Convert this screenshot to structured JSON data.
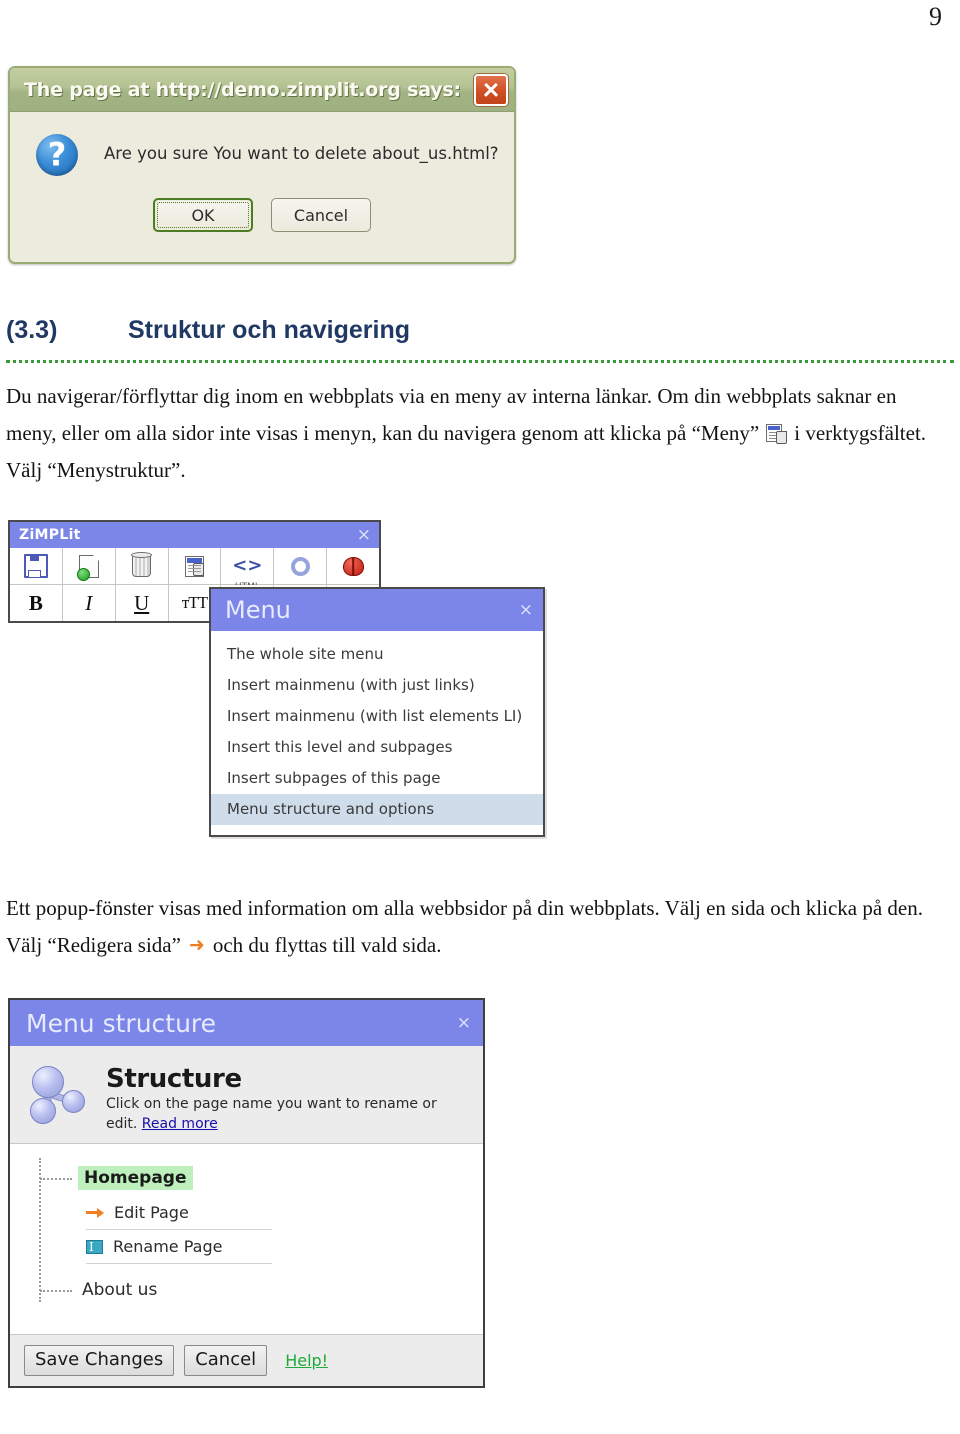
{
  "page": {
    "number": "9"
  },
  "alert_dialog": {
    "title": "The page at http://demo.zimplit.org says:",
    "message": "Are you sure You want to delete about_us.html?",
    "question_glyph": "?",
    "ok_label": "OK",
    "cancel_label": "Cancel",
    "close_label": "×"
  },
  "section": {
    "number": "(3.3)",
    "title": "Struktur och navigering",
    "heading_color": "#1f3864",
    "rule_color": "#3a9a3a"
  },
  "paragraphs": {
    "p1_part1": "Du navigerar/förflyttar dig inom en webbplats via en meny av interna länkar. Om din webbplats saknar en meny, eller om alla sidor inte visas i menyn, kan du navigera genom att klicka på “Meny”",
    "p1_part2": "i verktygsfältet.  Välj “Menystruktur”.",
    "p2_part1": "Ett popup-fönster visas med information om alla webbsidor på din webbplats. Välj en sida och klicka på den. Välj “Redigera sida”",
    "p2_arrow": "➜",
    "p2_part2": "och du flyttas till vald sida."
  },
  "zimplit_toolbar": {
    "title": "ZiMPLit",
    "close_label": "×",
    "row1": [
      {
        "icon": "save-icon",
        "label": ""
      },
      {
        "icon": "new-page-icon",
        "label": ""
      },
      {
        "icon": "trash-icon",
        "label": ""
      },
      {
        "icon": "menu-icon",
        "label": ""
      },
      {
        "icon": "html-code-icon",
        "label": "HTML"
      },
      {
        "icon": "gear-icon",
        "label": ""
      },
      {
        "icon": "ladybug-icon",
        "label": ""
      }
    ],
    "row2": [
      {
        "icon": "bold-icon",
        "label": "B"
      },
      {
        "icon": "italic-icon",
        "label": "I"
      },
      {
        "icon": "underline-icon",
        "label": "U"
      },
      {
        "icon": "font-size-icon",
        "label": "тTT"
      }
    ]
  },
  "menu_popup": {
    "title": "Menu",
    "close_label": "×",
    "items": [
      {
        "label": "The whole site menu",
        "selected": false
      },
      {
        "label": "Insert mainmenu (with just links)",
        "selected": false
      },
      {
        "label": "Insert mainmenu (with list elements LI)",
        "selected": false
      },
      {
        "label": "Insert this level and subpages",
        "selected": false
      },
      {
        "label": "Insert subpages of this page",
        "selected": false
      },
      {
        "label": "Menu structure and options",
        "selected": true
      }
    ],
    "selected_bg": "#cfdcea"
  },
  "structure_dialog": {
    "title": "Menu structure",
    "close_label": "×",
    "header": {
      "heading": "Structure",
      "hint_text": "Click on the page name you want to rename or edit.",
      "read_more_label": "Read more",
      "read_more_color": "#1a0dab"
    },
    "tree": {
      "homepage_label": "Homepage",
      "homepage_highlight": "#bdf0bd",
      "edit_page_label": "Edit Page",
      "rename_page_label": "Rename Page",
      "about_us_label": "About us"
    },
    "footer": {
      "save_label": "Save Changes",
      "cancel_label": "Cancel",
      "help_label": "Help!",
      "help_color": "#1faa3b"
    }
  }
}
